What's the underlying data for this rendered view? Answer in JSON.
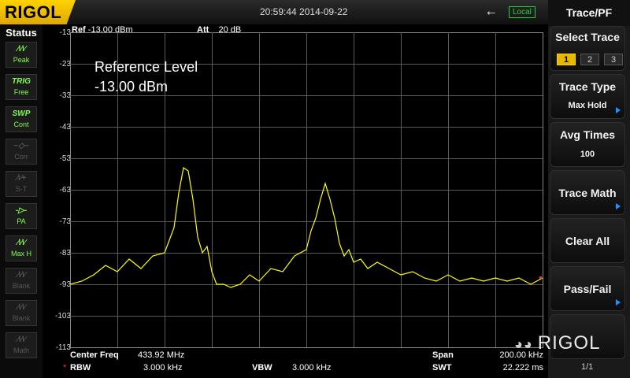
{
  "header": {
    "brand": "RIGOL",
    "datetime": "20:59:44 2014-09-22",
    "remote_status": "Local",
    "usb_icon": "usb-icon"
  },
  "status": {
    "title": "Status",
    "items": [
      {
        "icon_text": "∕\\∕\\∕",
        "label": "Peak",
        "active": true
      },
      {
        "icon_text": "TRIG",
        "label": "Free",
        "active": true
      },
      {
        "icon_text": "SWP",
        "label": "Cont",
        "active": true
      },
      {
        "icon_text": "~◇~",
        "label": "Corr",
        "active": false
      },
      {
        "icon_text": "∕\\∕+",
        "label": "S-T",
        "active": false
      },
      {
        "icon_text": "-▷-",
        "label": "PA",
        "active": true
      },
      {
        "icon_text": "∕\\∕\\∕",
        "label": "Max H",
        "active": true
      },
      {
        "icon_text": "∕\\∕\\∕",
        "label": "Blank",
        "active": false
      },
      {
        "icon_text": "∕\\∕\\∕",
        "label": "Blank",
        "active": false
      },
      {
        "icon_text": "∕\\∕\\∕",
        "label": "Math",
        "active": false
      }
    ]
  },
  "screen": {
    "ref_label": "Ref",
    "ref_value": "-13.00 dBm",
    "att_label": "Att",
    "att_value": "20 dB",
    "annotation_title": "Reference Level",
    "annotation_value": "-13.00 dBm",
    "y_labels": [
      "-13",
      "-23",
      "-33",
      "-43",
      "-53",
      "-63",
      "-73",
      "-83",
      "-93",
      "-103",
      "-113"
    ]
  },
  "footer": {
    "center_freq_label": "Center Freq",
    "center_freq_value": "433.92 MHz",
    "span_label": "Span",
    "span_value": "200.00 kHz",
    "rbw_marker": "*",
    "rbw_label": "RBW",
    "rbw_value": "3.000 kHz",
    "vbw_label": "VBW",
    "vbw_value": "3.000 kHz",
    "swt_label": "SWT",
    "swt_value": "22.222 ms"
  },
  "panel": {
    "title": "Trace/PF",
    "select_trace_label": "Select Trace",
    "trace_options": [
      "1",
      "2",
      "3"
    ],
    "selected_trace": "1",
    "trace_type_label": "Trace Type",
    "trace_type_value": "Max Hold",
    "avg_times_label": "Avg Times",
    "avg_times_value": "100",
    "trace_math_label": "Trace Math",
    "clear_all_label": "Clear All",
    "pass_fail_label": "Pass/Fail",
    "page_indicator": "1/1"
  },
  "watermark": {
    "text": "RIGOL",
    "icon": "wechat-icon"
  },
  "chart_data": {
    "type": "line",
    "title": "",
    "xlabel": "",
    "ylabel": "",
    "x_unit": "MHz",
    "y_unit": "dBm",
    "xlim": [
      433.82,
      434.02
    ],
    "ylim": [
      -113,
      -13
    ],
    "grid": true,
    "series": [
      {
        "color": "#ffff00",
        "x": [
          433.82,
          433.825,
          433.83,
          433.835,
          433.84,
          433.845,
          433.85,
          433.855,
          433.86,
          433.862,
          433.864,
          433.866,
          433.868,
          433.87,
          433.872,
          433.874,
          433.876,
          433.878,
          433.88,
          433.882,
          433.885,
          433.888,
          433.892,
          433.896,
          433.9,
          433.905,
          433.91,
          433.915,
          433.92,
          433.922,
          433.924,
          433.926,
          433.928,
          433.93,
          433.932,
          433.934,
          433.936,
          433.938,
          433.94,
          433.943,
          433.946,
          433.95,
          433.955,
          433.96,
          433.965,
          433.97,
          433.975,
          433.98,
          433.985,
          433.99,
          433.995,
          434.0,
          434.005,
          434.01,
          434.015,
          434.02
        ],
        "y": [
          -93,
          -92,
          -90,
          -87,
          -89,
          -85,
          -88,
          -84,
          -83,
          -79,
          -75,
          -64,
          -56,
          -57,
          -66,
          -78,
          -83,
          -81,
          -89,
          -93,
          -93,
          -94,
          -93,
          -90,
          -92,
          -88,
          -89,
          -84,
          -82,
          -76,
          -72,
          -66,
          -61,
          -66,
          -72,
          -80,
          -84,
          -82,
          -86,
          -85,
          -88,
          -86,
          -88,
          -90,
          -89,
          -91,
          -92,
          -90,
          -92,
          -91,
          -92,
          -91,
          -92,
          -91,
          -93,
          -91
        ]
      }
    ]
  }
}
